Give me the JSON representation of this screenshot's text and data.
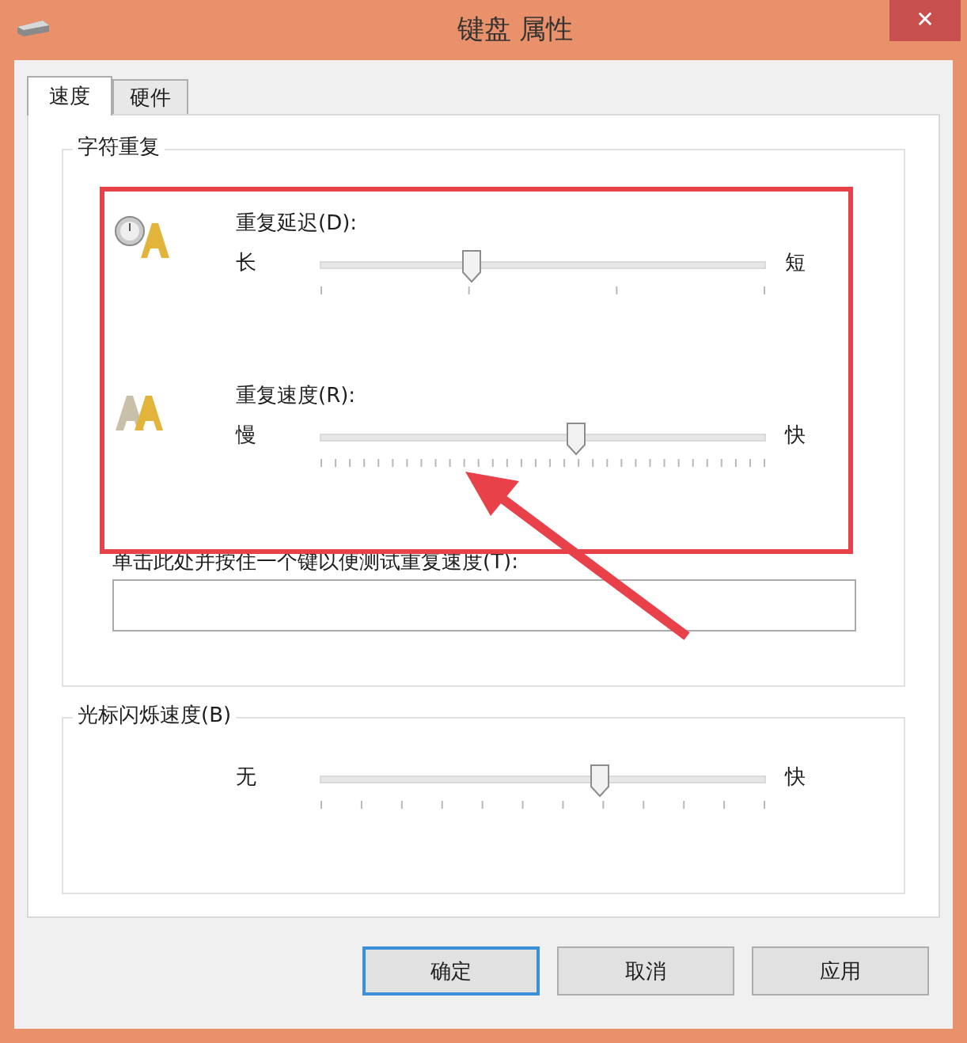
{
  "window": {
    "title": "键盘 属性",
    "close": "✕"
  },
  "tabs": [
    {
      "label": "速度",
      "selected": true
    },
    {
      "label": "硬件",
      "selected": false
    }
  ],
  "character_repeat": {
    "title": "字符重复",
    "sliders": [
      {
        "kind": "delay",
        "label": "重复延迟(D):",
        "min_label": "长",
        "max_label": "短",
        "level": 0.34
      },
      {
        "kind": "rate",
        "label": "重复速度(R):",
        "min_label": "慢",
        "max_label": "快",
        "level": 0.575
      }
    ],
    "test_label": "单击此处并按住一个键以便测试重复速度(T):"
  },
  "cursor_blink": {
    "title": "光标闪烁速度(B)",
    "slider": {
      "kind": "blink",
      "min_label": "无",
      "max_label": "快",
      "level": 0.63
    }
  },
  "buttons": [
    {
      "label": "确定",
      "focused": true
    },
    {
      "label": "取消",
      "focused": false
    },
    {
      "label": "应用",
      "focused": false
    }
  ],
  "annotations": {
    "frame": true,
    "arrow": true
  }
}
